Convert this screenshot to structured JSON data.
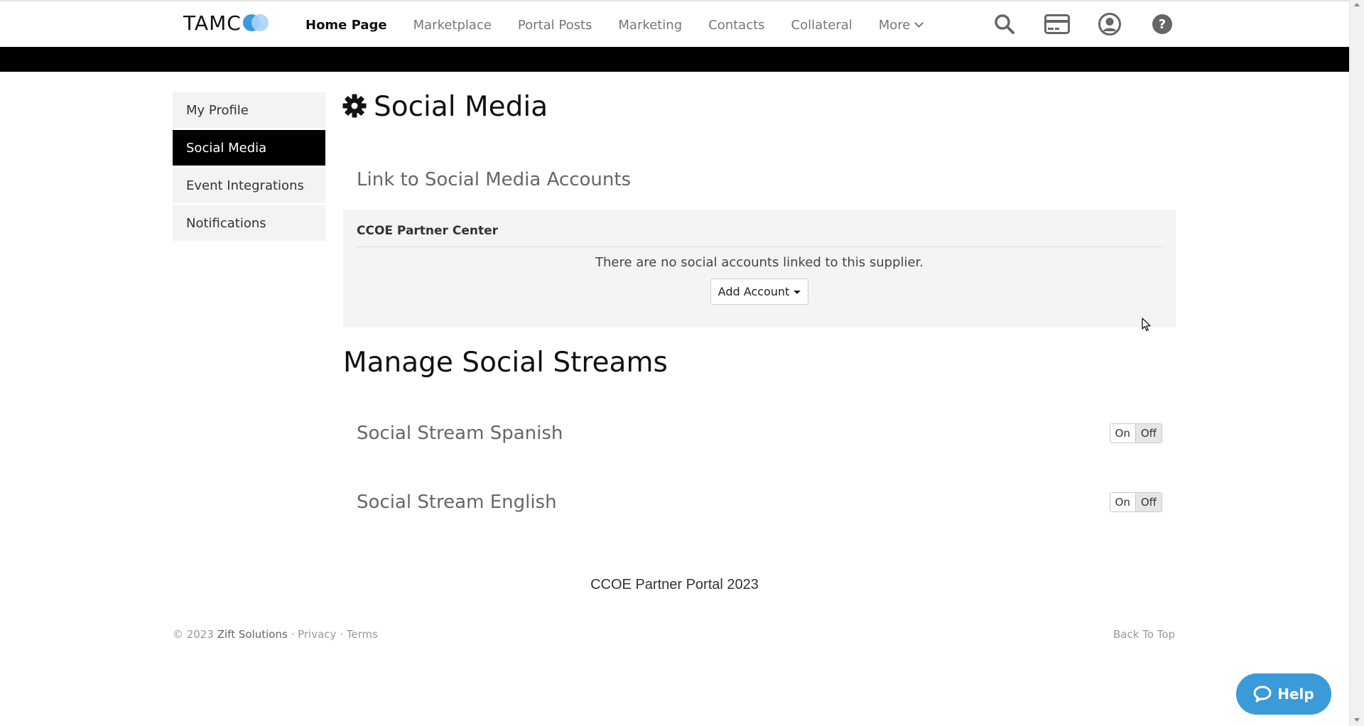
{
  "header": {
    "logo_text": "TAMC",
    "nav": [
      {
        "label": "Home Page",
        "active": true
      },
      {
        "label": "Marketplace"
      },
      {
        "label": "Portal Posts"
      },
      {
        "label": "Marketing"
      },
      {
        "label": "Contacts"
      },
      {
        "label": "Collateral"
      },
      {
        "label": "More"
      }
    ],
    "icons": [
      "search-icon",
      "credit-card-icon",
      "user-circle-icon",
      "question-circle-icon"
    ]
  },
  "sidebar": {
    "items": [
      {
        "label": "My Profile"
      },
      {
        "label": "Social Media",
        "active": true
      },
      {
        "label": "Event Integrations"
      },
      {
        "label": "Notifications"
      }
    ]
  },
  "main": {
    "title": "Social Media",
    "link_section": {
      "heading": "Link to Social Media Accounts",
      "card_title": "CCOE Partner Center",
      "message": "There are no social accounts linked to this supplier.",
      "add_button": "Add Account"
    },
    "manage_heading": "Manage Social Streams",
    "streams": [
      {
        "label": "Social Stream Spanish",
        "on_label": "On",
        "off_label": "Off",
        "state": "off"
      },
      {
        "label": "Social Stream English",
        "on_label": "On",
        "off_label": "Off",
        "state": "off"
      }
    ]
  },
  "footer": {
    "portal": "CCOE Partner Portal 2023",
    "copyright": "© 2023",
    "company": "Zift Solutions",
    "sep": "·",
    "privacy": "Privacy",
    "terms": "Terms",
    "back_to_top": "Back To Top"
  },
  "help_button": {
    "label": "Help"
  },
  "colors": {
    "accent": "#3a9bd8",
    "active_nav_bg": "#000000",
    "card_bg": "#f4f4f4"
  }
}
